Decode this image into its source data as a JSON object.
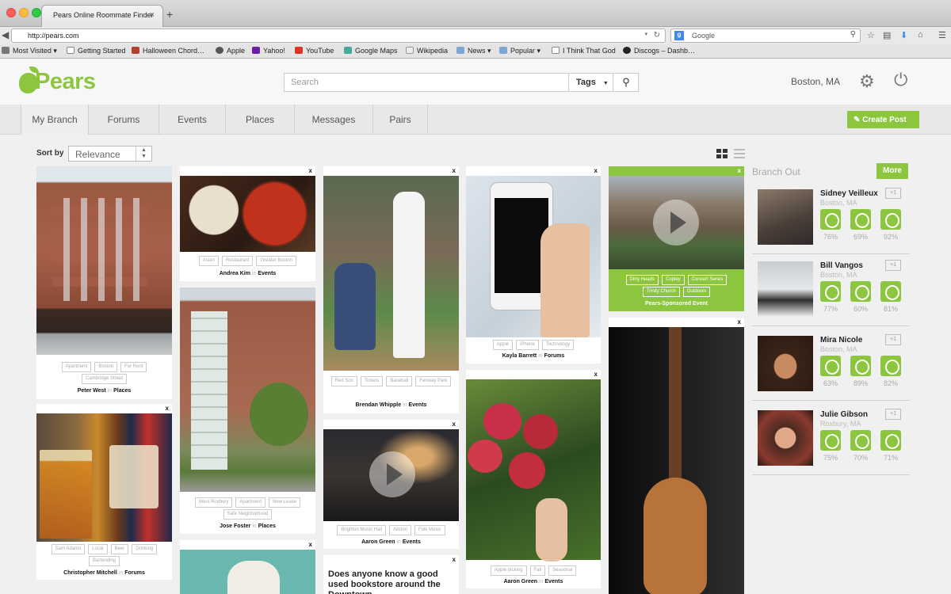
{
  "browser": {
    "tab_title": "Pears Online Roommate Finder",
    "tab_close": "×",
    "new_tab": "+",
    "url": "http://pears.com",
    "search_engine": "Google",
    "bookmarks": [
      "Most Visited",
      "Getting Started",
      "Halloween Chord…",
      "Apple",
      "Yahoo!",
      "YouTube",
      "Google Maps",
      "Wikipedia",
      "News",
      "Popular",
      "I Think That God",
      "Discogs – Dashb…"
    ]
  },
  "header": {
    "logo_text": "Pears",
    "search_placeholder": "Search",
    "tags_label": "Tags",
    "location": "Boston, MA"
  },
  "nav": {
    "items": [
      "My Branch",
      "Forums",
      "Events",
      "Places",
      "Messages",
      "Pairs"
    ],
    "create_post": "Create Post"
  },
  "sort": {
    "label": "Sort by",
    "value": "Relevance"
  },
  "cards": [
    {
      "id": "c1",
      "tags": [
        "Apartment",
        "Boston",
        "For Rent",
        "Cambridge Street"
      ],
      "author": "Peter West",
      "in": "in",
      "category": "Places"
    },
    {
      "id": "c2",
      "tags": [
        "Sam Adams",
        "Local",
        "Beer",
        "Drinking",
        "Bartending"
      ],
      "author": "Christopher Mitchell",
      "in": "in",
      "category": "Forums"
    },
    {
      "id": "c3",
      "tags": [
        "Asian",
        "Restaurant",
        "Greater Boston"
      ],
      "author": "Andrea Kim",
      "in": "in",
      "category": "Events"
    },
    {
      "id": "c4",
      "tags": [
        "West Roxbury",
        "Apartment",
        "New Lease",
        "Safe Neighborhood"
      ],
      "author": "Jose Foster",
      "in": "in",
      "category": "Places"
    },
    {
      "id": "c5",
      "tags": [
        "Red Sox",
        "Tickets",
        "Baseball",
        "Fenway Park"
      ],
      "author": "Brendan Whipple",
      "in": "in",
      "category": "Events"
    },
    {
      "id": "c6",
      "tags": [
        "Brighton Music Hall",
        "Allston",
        "Folk Music"
      ],
      "author": "Aaron Green",
      "in": "in",
      "category": "Events"
    },
    {
      "id": "c7",
      "question": "Does anyone know a good used bookstore around the Downtown"
    },
    {
      "id": "c8",
      "tags": [
        "Apple",
        "iPhone",
        "Technology"
      ],
      "author": "Kayla Barrett",
      "in": "in",
      "category": "Forums"
    },
    {
      "id": "c9",
      "tags": [
        "Apple picking",
        "Fall",
        "Seasonal"
      ],
      "author": "Aaron Green",
      "in": "in",
      "category": "Events"
    },
    {
      "id": "c10",
      "tags": [
        "Dirty Heads",
        "Copley",
        "Concert Series",
        "Trinity Church",
        "Outdoors"
      ],
      "author": "Pears-Sponsored Event"
    }
  ],
  "close_label": "x",
  "branch_out": {
    "title": "Branch Out",
    "more": "More",
    "plus": "+1",
    "people": [
      {
        "name": "Sidney Veilleux",
        "location": "Boston, MA",
        "scores": [
          "76%",
          "69%",
          "92%"
        ]
      },
      {
        "name": "Bill Vangos",
        "location": "Boston, MA",
        "scores": [
          "77%",
          "60%",
          "81%"
        ]
      },
      {
        "name": "Mira Nicole",
        "location": "Boston, MA",
        "scores": [
          "63%",
          "89%",
          "82%"
        ]
      },
      {
        "name": "Julie Gibson",
        "location": "Roxbury, MA",
        "scores": [
          "75%",
          "70%",
          "71%"
        ]
      }
    ]
  },
  "colors": {
    "brand_green": "#8cc63f"
  }
}
